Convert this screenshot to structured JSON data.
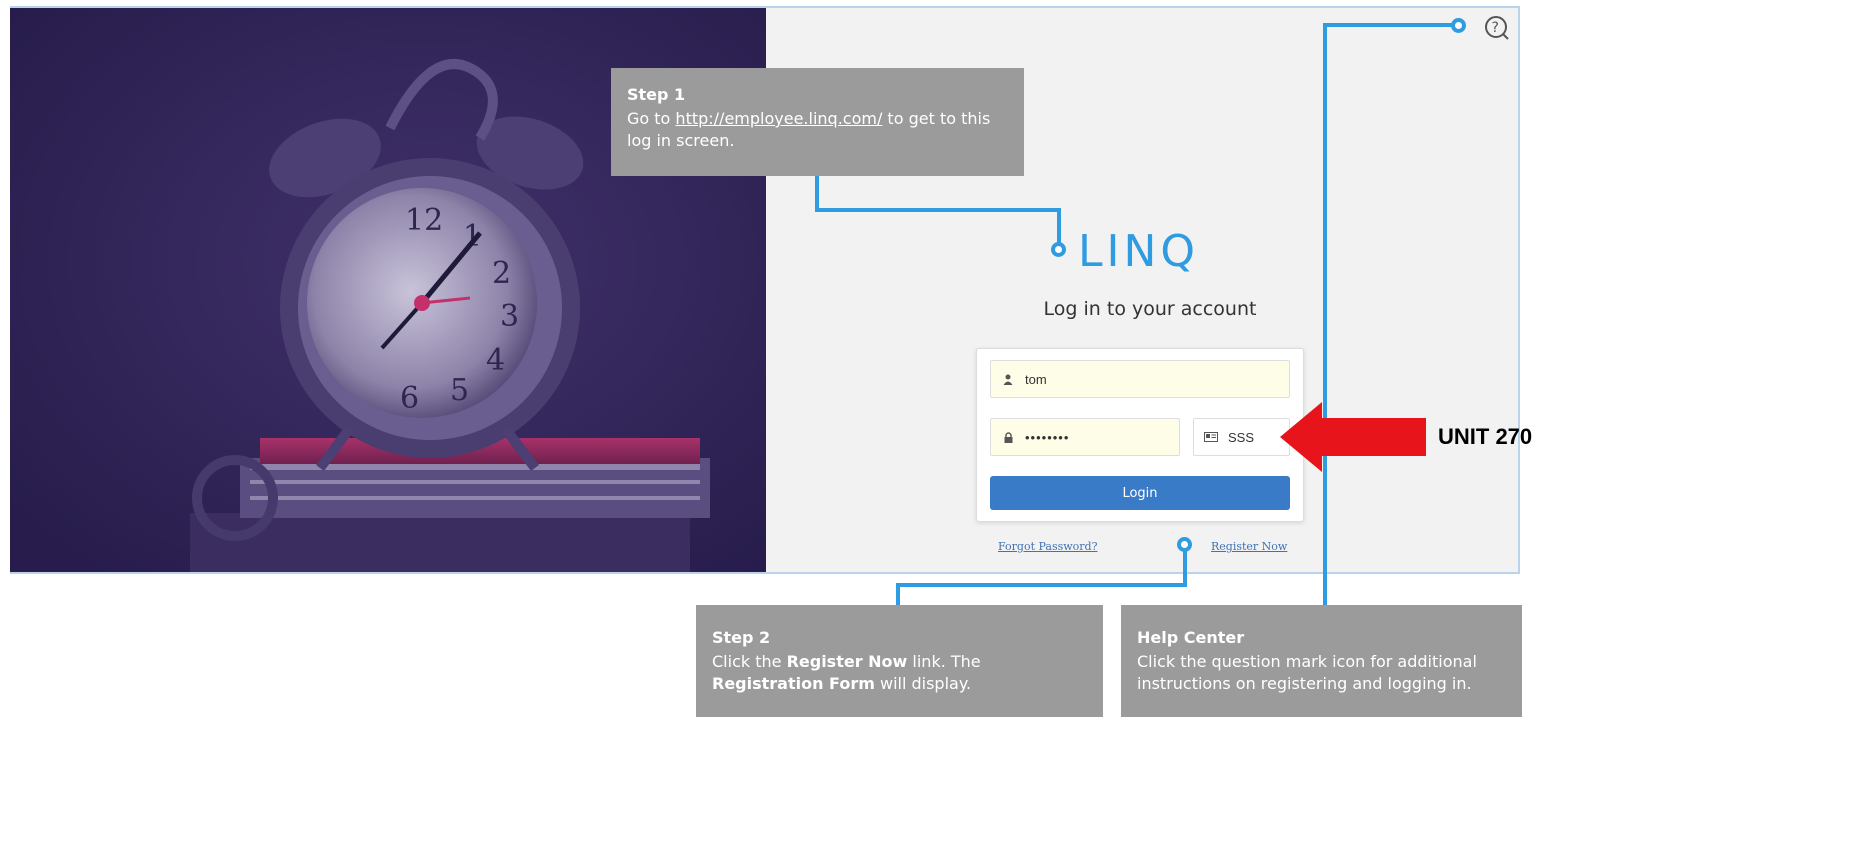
{
  "step1": {
    "title": "Step 1",
    "text_before": "Go to ",
    "link": "http://employee.linq.com/",
    "text_after": " to get to this log in screen."
  },
  "brand": {
    "logo": "LINQ"
  },
  "login": {
    "heading": "Log in to your account",
    "username_value": "tom",
    "password_value": "••••••••",
    "district_value": "SSS",
    "login_label": "Login",
    "forgot_label": "Forgot Password?",
    "register_label": "Register Now"
  },
  "step2": {
    "title": "Step 2",
    "p1": "Click the ",
    "b1": "Register Now",
    "p2": " link. The ",
    "b2": "Registration Form",
    "p3": " will display."
  },
  "help": {
    "title": "Help Center",
    "text": "Click the question mark icon for additional instructions on registering and logging in."
  },
  "annotation": {
    "label": "UNIT 270"
  },
  "icons": {
    "help": "question-circle-icon",
    "user": "user-icon",
    "lock": "lock-icon",
    "id_card": "id-card-icon",
    "arrow": "red-arrow-icon"
  },
  "colors": {
    "accent": "#2f9be0",
    "button": "#3a7bc8",
    "callout": "#9b9b9b",
    "hero_tint": "#3a2a63",
    "arrow": "#e8141b"
  }
}
